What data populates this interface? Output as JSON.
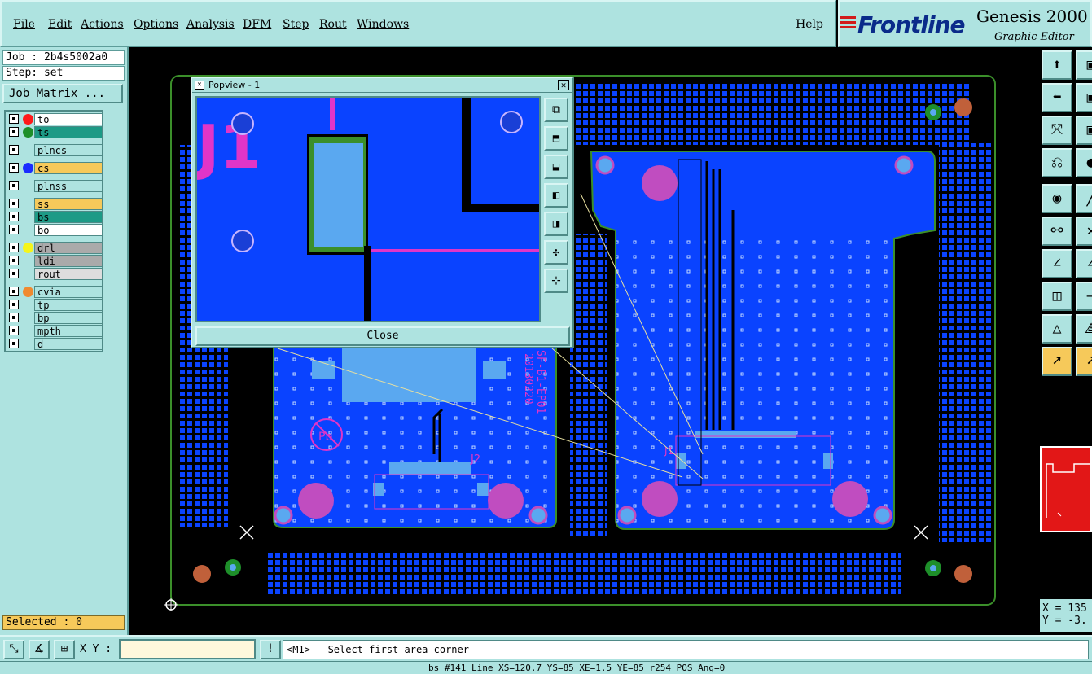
{
  "menubar": {
    "items": [
      "File",
      "Edit",
      "Actions",
      "Options",
      "Analysis",
      "DFM",
      "Step",
      "Rout",
      "Windows"
    ],
    "help": "Help"
  },
  "brand": {
    "logo": "Frontline",
    "product": "Genesis 2000",
    "subtitle": "Graphic Editor"
  },
  "left": {
    "job": "Job : 2b4s5002a0",
    "step": "Step: set",
    "job_matrix": "Job Matrix ...",
    "selected": "Selected : 0"
  },
  "layers": [
    {
      "name": "to",
      "color": "#ff1a1a",
      "bg": "#ffffff",
      "group": 0
    },
    {
      "name": "ts",
      "color": "#1e8f2a",
      "bg": "#1d9a86",
      "group": 0
    },
    {
      "name": "plncs",
      "color": "",
      "bg": "#aee3e0",
      "group": 1
    },
    {
      "name": "cs",
      "color": "#1a2cff",
      "bg": "#f6c95a",
      "group": 2
    },
    {
      "name": "plnss",
      "color": "",
      "bg": "#aee3e0",
      "group": 3
    },
    {
      "name": "ss",
      "color": "",
      "bg": "#f6c95a",
      "group": 4
    },
    {
      "name": "bs",
      "color": "",
      "bg": "#1d9a86",
      "group": 4
    },
    {
      "name": "bo",
      "color": "",
      "bg": "#ffffff",
      "group": 4
    },
    {
      "name": "drl",
      "color": "#f5f51a",
      "bg": "#aaaaaa",
      "group": 5
    },
    {
      "name": "ldi",
      "color": "",
      "bg": "#aaaaaa",
      "group": 5
    },
    {
      "name": "rout",
      "color": "",
      "bg": "#dddddd",
      "group": 5
    },
    {
      "name": "cvia",
      "color": "#f08a30",
      "bg": "#aee3e0",
      "group": 6
    },
    {
      "name": "tp",
      "color": "",
      "bg": "#aee3e0",
      "group": 6
    },
    {
      "name": "bp",
      "color": "",
      "bg": "#aee3e0",
      "group": 6
    },
    {
      "name": "mpth",
      "color": "",
      "bg": "#aee3e0",
      "group": 6
    },
    {
      "name": "d",
      "color": "",
      "bg": "#aee3e0",
      "group": 6
    }
  ],
  "popview": {
    "title": "Popview - 1",
    "close": "Close",
    "label": "J1"
  },
  "board": {
    "silk_text_1": "J2",
    "silk_text_2": "J1",
    "silk_date": "20130220",
    "silk_code": "SF-B1-EP01",
    "silk_pb": "Pb"
  },
  "bottom": {
    "xy_label": "X Y :",
    "xy_value": "",
    "info_btn": "!",
    "prompt": "<M1> - Select first area corner",
    "status": "bs #141 Line XS=120.7 YS=85 XE=1.5 YE=85 r254 POS Ang=0"
  },
  "coords": {
    "x": "X = 135",
    "y": "Y = -3."
  },
  "colors": {
    "panel": "#aee3e0",
    "board_blue": "#0a43ff",
    "trace_magenta": "#e135c8",
    "outline_green": "#3b8f2a"
  }
}
